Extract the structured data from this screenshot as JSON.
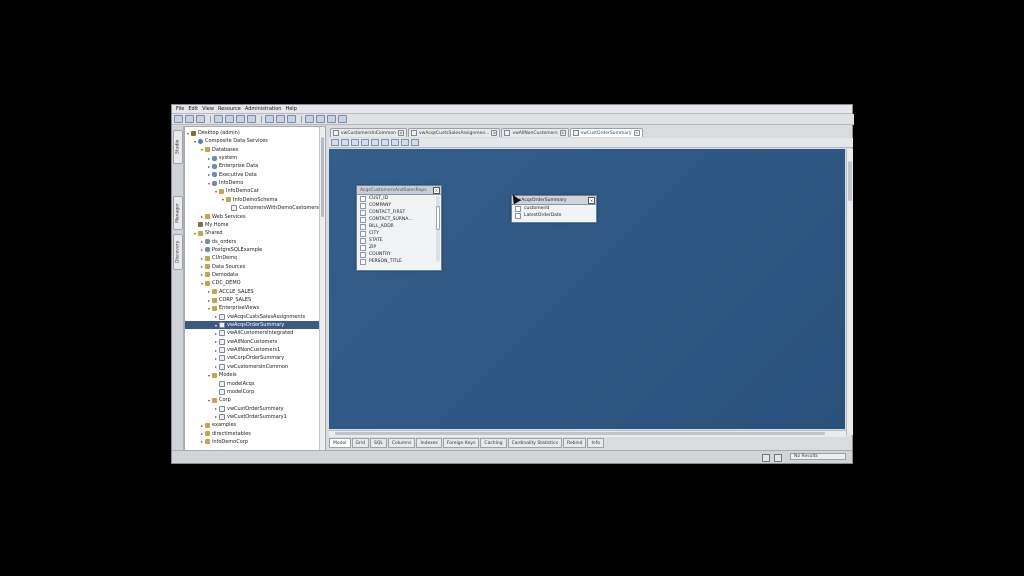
{
  "menu": [
    "File",
    "Edit",
    "View",
    "Resource",
    "Administration",
    "Help"
  ],
  "side_tabs": [
    "Studio",
    "Manager",
    "Discovery"
  ],
  "tree": [
    {
      "label": "Desktop (admin)",
      "indent": 0,
      "icon": "home",
      "tw": "▾"
    },
    {
      "label": "Composite Data Services",
      "indent": 1,
      "icon": "comp",
      "tw": "▾"
    },
    {
      "label": "Databases",
      "indent": 2,
      "icon": "folder",
      "tw": "▾"
    },
    {
      "label": "system",
      "indent": 3,
      "icon": "db",
      "tw": "▸"
    },
    {
      "label": "Enterprise Data",
      "indent": 3,
      "icon": "db",
      "tw": "▸"
    },
    {
      "label": "Executive Data",
      "indent": 3,
      "icon": "db",
      "tw": "▸"
    },
    {
      "label": "InfoDemo",
      "indent": 3,
      "icon": "db",
      "tw": "▾"
    },
    {
      "label": "InfoDemoCat",
      "indent": 4,
      "icon": "folder",
      "tw": "▾"
    },
    {
      "label": "InfoDemoSchema",
      "indent": 5,
      "icon": "folder",
      "tw": "▾"
    },
    {
      "label": "CustomersWithDemoCastomers",
      "indent": 6,
      "icon": "view",
      "tw": ""
    },
    {
      "label": "Web Services",
      "indent": 2,
      "icon": "folder",
      "tw": "▸"
    },
    {
      "label": "My Home",
      "indent": 1,
      "icon": "home",
      "tw": ""
    },
    {
      "label": "Shared",
      "indent": 1,
      "icon": "folder",
      "tw": "▾"
    },
    {
      "label": "ds_orders",
      "indent": 2,
      "icon": "db",
      "tw": "▸"
    },
    {
      "label": "PostgreSQLExample",
      "indent": 2,
      "icon": "db",
      "tw": "▸"
    },
    {
      "label": "CUnDemo",
      "indent": 2,
      "icon": "folder",
      "tw": "▸"
    },
    {
      "label": "Data Sources",
      "indent": 2,
      "icon": "folder",
      "tw": "▸"
    },
    {
      "label": "Demodata",
      "indent": 2,
      "icon": "folder",
      "tw": "▸"
    },
    {
      "label": "CDC_DEMO",
      "indent": 2,
      "icon": "folder",
      "tw": "▾"
    },
    {
      "label": "ACCLE_SALES",
      "indent": 3,
      "icon": "folder",
      "tw": "▸"
    },
    {
      "label": "CORP_SALES",
      "indent": 3,
      "icon": "folder",
      "tw": "▸"
    },
    {
      "label": "EnterpriseViews",
      "indent": 3,
      "icon": "folder",
      "tw": "▾"
    },
    {
      "label": "vwAcqsCustsSalesAssignments",
      "indent": 4,
      "icon": "view",
      "tw": "▸"
    },
    {
      "label": "vwAcqsOrderSummary",
      "indent": 4,
      "icon": "view",
      "tw": "▾",
      "selected": true
    },
    {
      "label": "vwAllCustomersIntegrated",
      "indent": 4,
      "icon": "view",
      "tw": "▸"
    },
    {
      "label": "vwAllNonCustomers",
      "indent": 4,
      "icon": "view",
      "tw": "▸"
    },
    {
      "label": "vwAllNonCustomers1",
      "indent": 4,
      "icon": "view",
      "tw": "▸"
    },
    {
      "label": "vwCorpOrderSummary",
      "indent": 4,
      "icon": "view",
      "tw": "▸"
    },
    {
      "label": "vwCustomersInCommon",
      "indent": 4,
      "icon": "view",
      "tw": "▸"
    },
    {
      "label": "Models",
      "indent": 3,
      "icon": "folder",
      "tw": "▾"
    },
    {
      "label": "modelAcqs",
      "indent": 4,
      "icon": "view",
      "tw": ""
    },
    {
      "label": "modelCorp",
      "indent": 4,
      "icon": "view",
      "tw": ""
    },
    {
      "label": "Corp",
      "indent": 3,
      "icon": "folder",
      "tw": "▾"
    },
    {
      "label": "vwCustOrderSummary",
      "indent": 4,
      "icon": "view",
      "tw": "▸"
    },
    {
      "label": "vwCustOrderSummary1",
      "indent": 4,
      "icon": "view",
      "tw": "▸"
    },
    {
      "label": "examples",
      "indent": 2,
      "icon": "folder",
      "tw": "▸"
    },
    {
      "label": "directimetables",
      "indent": 2,
      "icon": "folder",
      "tw": "▸"
    },
    {
      "label": "infoDemoCorp",
      "indent": 2,
      "icon": "folder",
      "tw": "▸"
    }
  ],
  "editor_tabs": [
    {
      "label": "vwCustomersInCommon",
      "active": false
    },
    {
      "label": "vwAcqsCustsSalesAssignmen...",
      "active": false
    },
    {
      "label": "vwAllNonCustomers",
      "active": false
    },
    {
      "label": "vwCustOrderSummary",
      "active": true
    }
  ],
  "entity_left": {
    "title": "AcqsCustomersAndSalesReps",
    "columns": [
      "CUST_ID",
      "COMPANY",
      "CONTACT_FIRST",
      "CONTACT_SURNA...",
      "BILL_ADDR",
      "CITY",
      "STATE",
      "ZIP",
      "COUNTRY",
      "PERSON_TITLE"
    ]
  },
  "entity_right": {
    "title": "vwAcqsOrderSummary",
    "columns": [
      "customerId",
      "LatestOrderDate"
    ]
  },
  "bottom_tabs": [
    {
      "label": "Model",
      "active": true
    },
    {
      "label": "Grid",
      "active": false
    },
    {
      "label": "SQL",
      "active": false
    },
    {
      "label": "Columns",
      "active": false
    },
    {
      "label": "Indexes",
      "active": false
    },
    {
      "label": "Foreign Keys",
      "active": false
    },
    {
      "label": "Caching",
      "active": false
    },
    {
      "label": "Cardinality Statistics",
      "active": false
    },
    {
      "label": "Rebind",
      "active": false
    },
    {
      "label": "Info",
      "active": false
    }
  ],
  "status_text": "No Results"
}
